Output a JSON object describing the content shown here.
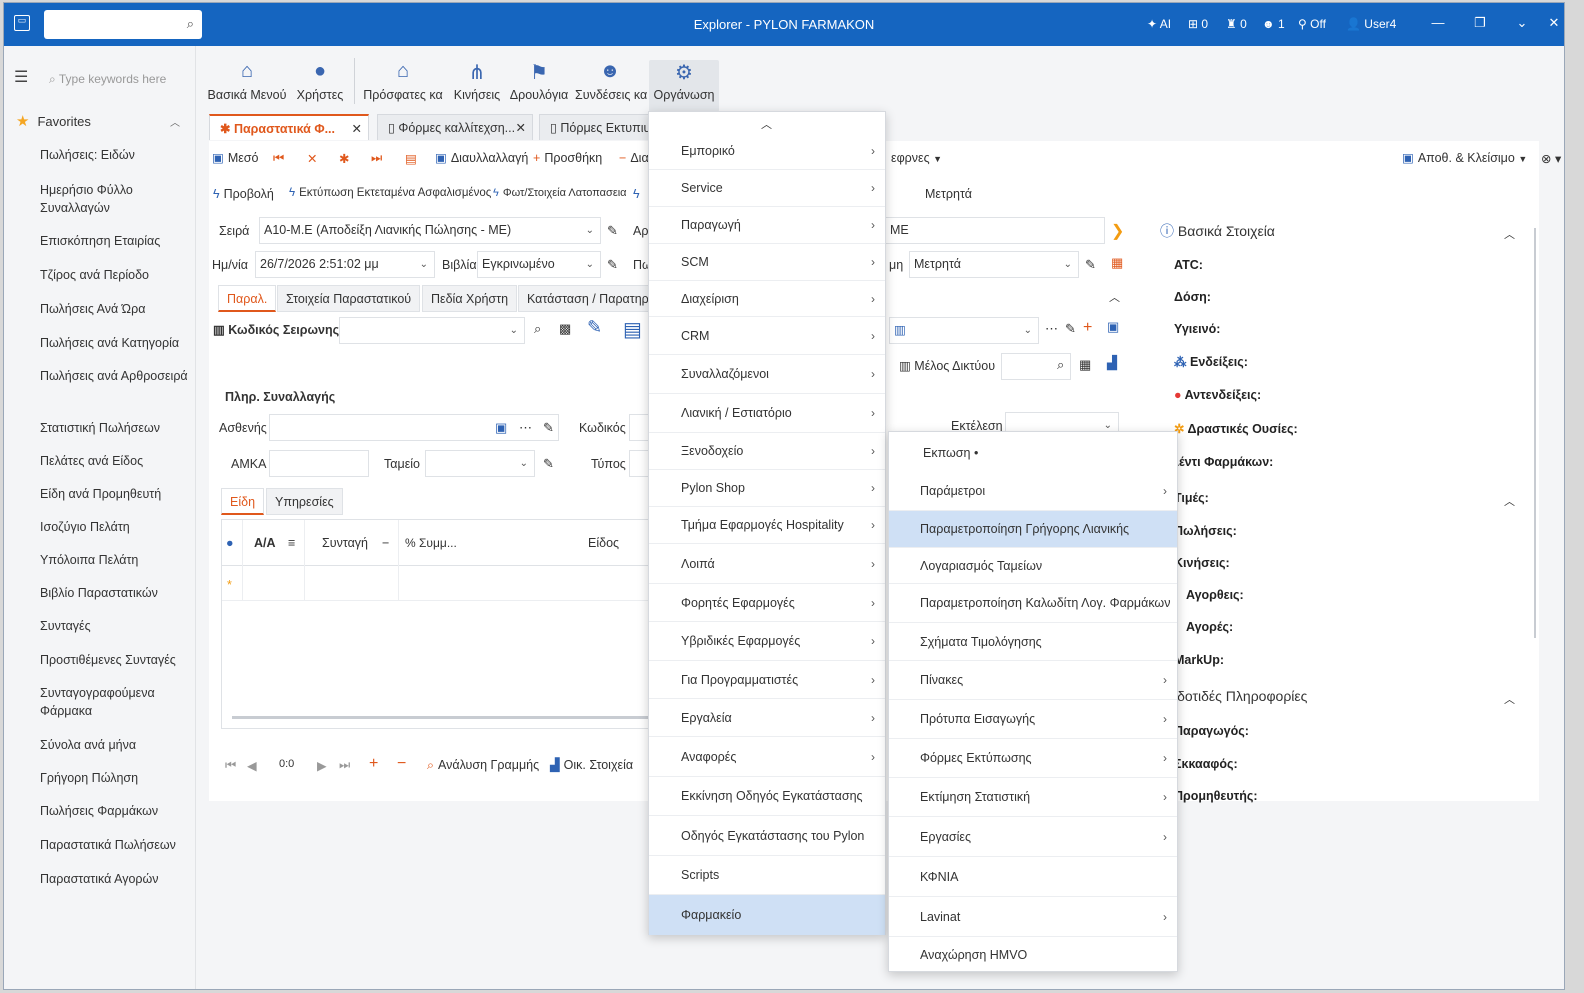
{
  "window": {
    "title": "Explorer - PYLON FARMAKON"
  },
  "status": {
    "ai": "AI",
    "s1": "0",
    "s2": "0",
    "s3": "1",
    "off": "Off",
    "user": "User4"
  },
  "sidebar": {
    "search_placeholder": "Type keywords here",
    "favorites": "Favorites",
    "items": [
      "Πωλήσεις: Ειδών",
      "Ημερήσιο Φύλλο Συναλλαγών",
      "Επισκόπηση Εταιρίας",
      "Τζίρος ανά Περίοδο",
      "Πωλήσεις Ανά Ώρα",
      "Πωλήσεις ανά Κατηγορία",
      "Πωλήσεις ανά Αρθροσειρά",
      "Στατιστική Πωλήσεων",
      "Πελάτες ανά Είδος",
      "Είδη ανά Προμηθευτή",
      "Ισοζύγιο Πελάτη",
      "Υπόλοιπα Πελάτη",
      "Βιβλίο Παραστατικών",
      "Συνταγές",
      "Προστιθέμενες Συνταγές",
      "Συνταγογραφούμενα Φάρμακα",
      "Σύνολα ανά μήνα",
      "Γρήγορη Πώληση",
      "Πωλήσεις Φαρμάκων",
      "Παραστατικά Πωλήσεων",
      "Παραστατικά Αγορών"
    ]
  },
  "ribbon": [
    "Βασικά Μενού",
    "Χρήστες",
    "Πρόσφατες κα",
    "Κινήσεις",
    "Δρουλόγια",
    "Συνδέσεις κα",
    "Οργάνωση"
  ],
  "tabs": [
    "Παραστατικά Φ...",
    "Φόρμες καλλίτεχση...",
    "Πόρμες Εκτυπιυ"
  ],
  "toolbar": {
    "meso": "Μεσό",
    "diav": "Διαυλλαλλαγή",
    "add": "Προσθήκη",
    "del": "Δια",
    "combos": "εφρνες",
    "save_close": "Αποθ. & Κλείσιμο"
  },
  "actions": {
    "prov": "Προβολή",
    "print": "Εκτύπωση Εκτεταμένα Ασφαλισμένος",
    "fwt": "Φωτ/Στοιχεία Λατοπασεια",
    "metr": "Μετρητά"
  },
  "form": {
    "seira_label": "Σειρά",
    "seira_value": "A10-M.E (Αποδείξη Λιανικής Πώλησης - ME)",
    "ar_label": "Αρ",
    "date_label": "Ημ/νία",
    "date_value": "26/7/2026 2:51:02 μμ",
    "vivlia_label": "Βιβλία",
    "vivlia_value": "Εγκρινωμένο",
    "pl_label": "Πω",
    "me_value": "ME",
    "method_label": "μη",
    "method_value": "Μετρητά",
    "subtabs": [
      "Παραλ.",
      "Στοιχεία Παραστατικού",
      "Πεδία Χρήστη",
      "Κατάσταση / Παρατηρ"
    ],
    "kod_seir": "Κωδικός Σειρωνης",
    "melos": "Μέλος Δικτύου",
    "plir": "Πληρ. Συναλλαγής",
    "asthenis": "Ασθενής",
    "kodikos": "Κωδικός",
    "ektelesi": "Εκτέλεση",
    "amka": "ΑΜΚΑ",
    "tameio": "Ταμείο",
    "typos": "Τύπος",
    "item_tabs": [
      "Είδη",
      "Υπηρεσίες"
    ],
    "grid_headers": [
      "Α/Α",
      "Συνταγή",
      "% Συμμ...",
      "Είδος"
    ],
    "nav_count": "0:0",
    "analysis": "Ανάλυση Γραμμής",
    "oik": "Οικ. Στοιχεία"
  },
  "rpanel": {
    "title": "Βασικά Στοιχεία",
    "fields": [
      "ATC:",
      "Δόση:",
      "Υγιεινό:",
      "Ενδείξεις:",
      "Αντενδείξεις:",
      "Δραστικές Ουσίες:",
      "λέντι Φαρμάκων:"
    ],
    "prices": "Τιμές:",
    "price_fields": [
      "Πωλήσεις:",
      "Κινήσεις:",
      "Αγορθεις:",
      "Αγορές:",
      "MarkUp:"
    ],
    "more": "ιδοτιδές Πληροφορίες",
    "more_fields": [
      "Παραγωγός:",
      "Σκκααφός:",
      "Προμηθευτής:"
    ]
  },
  "menu1": [
    "Εμπορικό",
    "Service",
    "Παραγωγή",
    "SCM",
    "Διαχείριση",
    "CRM",
    "Συναλλαζόμενοι",
    "Λιανική / Εστιατόριο",
    "Ξενοδοχείο",
    "Pylon Shop",
    "Τμήμα Εφαρμογές Hospitality",
    "Λοιπά",
    "Φορητές Εφαρμογές",
    "Υβριδικές Εφαρμογές",
    "Για Προγραμματιστές",
    "Εργαλεία",
    "Αναφορές",
    "Εκκίνηση Οδηγός Εγκατάστασης",
    "Οδηγός Εγκατάστασης του Pylon",
    "Scripts",
    "Φαρμακείο"
  ],
  "menu2": [
    "Εκπωση",
    "Παράμετροι",
    "Παραμετροποίηση Γρήγορης Λιανικής",
    "Λογαριασμός Ταμείων",
    "Παραμετροποίηση Καλωδίτη Λογ. Φαρμάκων",
    "Σχήματα Τιμολόγησης",
    "Πίνακες",
    "Πρότυπα Εισαγωγής",
    "Φόρμες Εκτύπωσης",
    "Εκτίμηση Στατιστική",
    "Εργασίες",
    "ΚΦΝΙΑ",
    "Lavinat",
    "Αναχώρηση HMVO"
  ]
}
